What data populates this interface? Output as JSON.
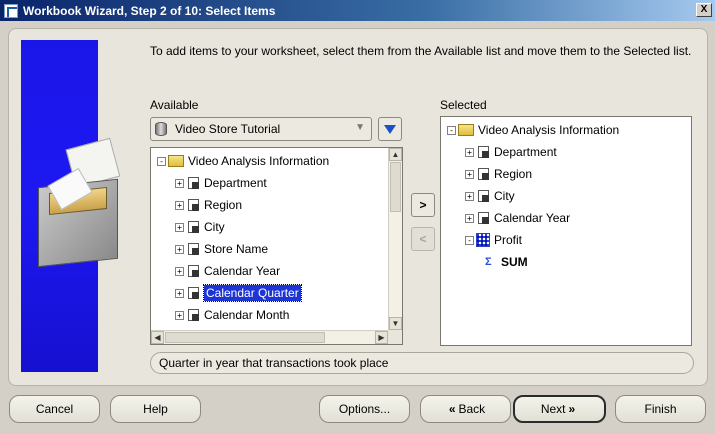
{
  "window": {
    "title": "Workbook Wizard, Step 2 of 10: Select Items",
    "close_glyph": "X"
  },
  "intro_text": "To add items to your worksheet, select them from the Available list and move them to the Selected list.",
  "available": {
    "label": "Available",
    "business_area": "Video Store Tutorial",
    "items": [
      {
        "label": "Video Analysis Information",
        "type": "folder",
        "expander": "-"
      },
      {
        "label": "Department",
        "type": "dimension",
        "expander": "+"
      },
      {
        "label": "Region",
        "type": "dimension",
        "expander": "+"
      },
      {
        "label": "City",
        "type": "dimension",
        "expander": "+"
      },
      {
        "label": "Store Name",
        "type": "dimension",
        "expander": "+"
      },
      {
        "label": "Calendar Year",
        "type": "dimension",
        "expander": "+"
      },
      {
        "label": "Calendar Quarter",
        "type": "dimension",
        "expander": "+",
        "selected": true
      },
      {
        "label": "Calendar Month",
        "type": "dimension",
        "expander": "+"
      }
    ]
  },
  "selected": {
    "label": "Selected",
    "items": [
      {
        "label": "Video Analysis Information",
        "type": "folder",
        "expander": "-"
      },
      {
        "label": "Department",
        "type": "dimension",
        "expander": "+"
      },
      {
        "label": "Region",
        "type": "dimension",
        "expander": "+"
      },
      {
        "label": "City",
        "type": "dimension",
        "expander": "+"
      },
      {
        "label": "Calendar Year",
        "type": "dimension",
        "expander": "+"
      },
      {
        "label": "Profit",
        "type": "measure",
        "expander": "-"
      },
      {
        "label": "SUM",
        "type": "aggregate"
      }
    ]
  },
  "move_buttons": {
    "add_glyph": ">",
    "remove_glyph": "<"
  },
  "description": "Quarter in year that transactions took place",
  "buttons": {
    "cancel": "Cancel",
    "help": "Help",
    "options": "Options...",
    "back": "Back",
    "back_glyph": "«",
    "next": "Next",
    "next_glyph": "»",
    "finish": "Finish"
  },
  "icons": {
    "app": "wizard-icon",
    "business_area": "database-icon",
    "filter": "funnel-icon",
    "folder": "folder-icon",
    "dimension": "dimension-item-icon",
    "measure": "measure-icon",
    "aggregate": "sum-icon"
  },
  "colors": {
    "title_bar": "#0a246a",
    "selection": "#1d35d4",
    "side_panel": "#1b16e8"
  }
}
